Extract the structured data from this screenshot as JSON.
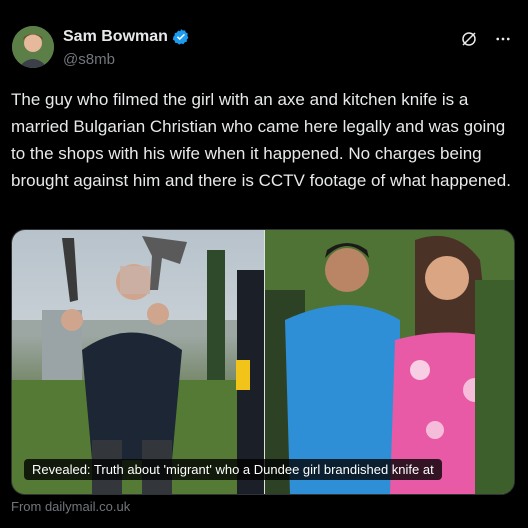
{
  "author": {
    "name": "Sam Bowman",
    "handle": "@s8mb"
  },
  "tweet": {
    "text": "The guy who filmed the girl with an axe and kitchen knife is a married Bulgarian Christian who came here legally and was going to the shops with his wife when it happened. No charges being brought against him and there is CCTV footage of what happened."
  },
  "card": {
    "headline": "Revealed: Truth about 'migrant' who a Dundee girl brandished knife at",
    "source": "From dailymail.co.uk"
  },
  "icons": {
    "verified": "verified-badge-icon",
    "grok": "grok-icon",
    "more": "more-options-icon"
  },
  "colors": {
    "background": "#000000",
    "text": "#e7e9ea",
    "secondary_text": "#71767b",
    "verified_blue": "#1d9bf0"
  }
}
